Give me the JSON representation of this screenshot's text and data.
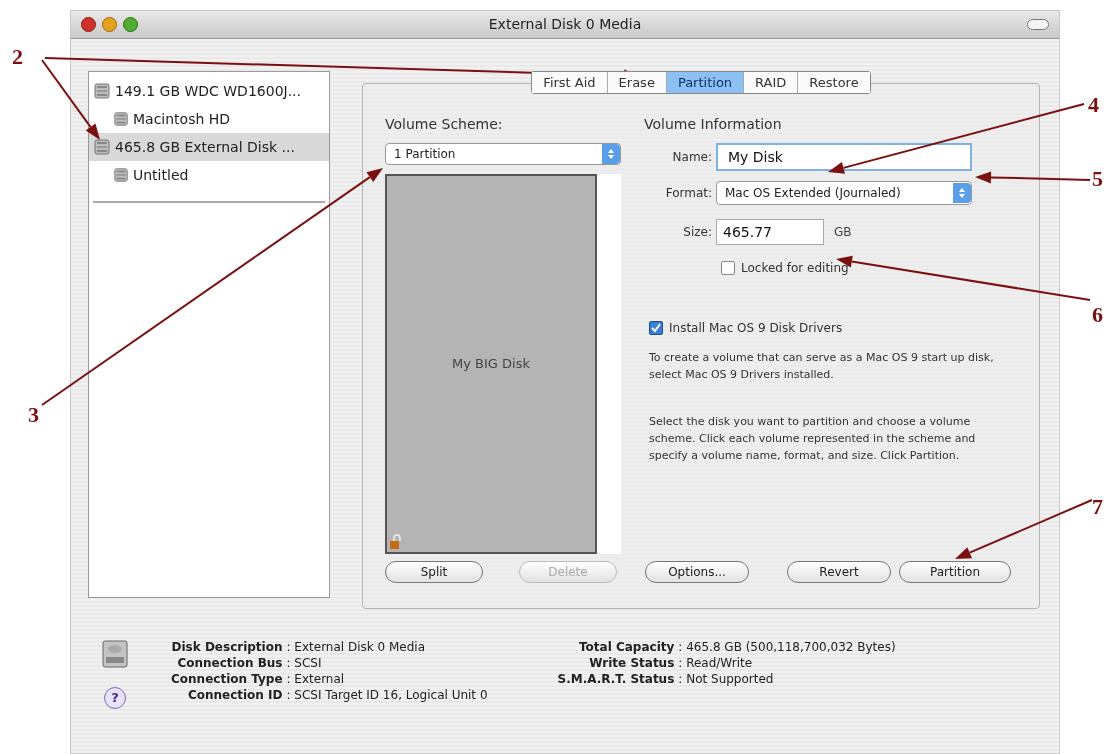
{
  "window": {
    "title": "External Disk 0 Media"
  },
  "sidebar": {
    "items": [
      {
        "label": "149.1 GB WDC WD1600J...",
        "selected": false,
        "children": [
          {
            "label": "Macintosh HD",
            "selected": false
          }
        ]
      },
      {
        "label": "465.8 GB External Disk ...",
        "selected": true,
        "children": [
          {
            "label": "Untitled",
            "selected": false
          }
        ]
      }
    ]
  },
  "tabs": [
    {
      "label": "First Aid",
      "selected": false
    },
    {
      "label": "Erase",
      "selected": false
    },
    {
      "label": "Partition",
      "selected": true
    },
    {
      "label": "RAID",
      "selected": false
    },
    {
      "label": "Restore",
      "selected": false
    }
  ],
  "volume_scheme": {
    "heading": "Volume Scheme:",
    "popup": "1 Partition",
    "volume_label": "My BIG Disk"
  },
  "volume_information": {
    "heading": "Volume Information",
    "name_label": "Name:",
    "name_value": "My Disk",
    "format_label": "Format:",
    "format_value": "Mac OS Extended (Journaled)",
    "size_label": "Size:",
    "size_value": "465.77",
    "size_unit": "GB",
    "locked": {
      "label": "Locked for editing",
      "checked": false
    },
    "install_drivers": {
      "label": "Install Mac OS 9 Disk Drivers",
      "checked": true
    },
    "note": "To create a volume that can serve as a Mac OS 9 start up disk, select Mac OS 9 Drivers installed.",
    "instructions": "Select the disk you want to partition and choose a volume scheme. Click each volume represented in the scheme and specify a volume name, format, and size. Click Partition."
  },
  "buttons": [
    {
      "label": "Split",
      "disabled": false
    },
    {
      "label": "Delete",
      "disabled": true
    },
    {
      "label": "Options...",
      "disabled": false
    },
    {
      "label": "Revert",
      "disabled": false
    },
    {
      "label": "Partition",
      "disabled": false
    }
  ],
  "disk_info": {
    "left": [
      {
        "label": "Disk Description",
        "value": "External Disk 0 Media"
      },
      {
        "label": "Connection Bus",
        "value": "SCSI"
      },
      {
        "label": "Connection Type",
        "value": "External"
      },
      {
        "label": "Connection ID",
        "value": "SCSI Target ID 16, Logical Unit 0"
      }
    ],
    "right": [
      {
        "label": "Total Capacity",
        "value": "465.8 GB (500,118,700,032 Bytes)"
      },
      {
        "label": "Write Status",
        "value": "Read/Write"
      },
      {
        "label": "S.M.A.R.T. Status",
        "value": "Not Supported"
      }
    ],
    "separator": ":",
    "help": "?"
  },
  "annotations": [
    {
      "label": "2"
    },
    {
      "label": "3"
    },
    {
      "label": "4"
    },
    {
      "label": "5"
    },
    {
      "label": "6"
    },
    {
      "label": "7"
    }
  ]
}
